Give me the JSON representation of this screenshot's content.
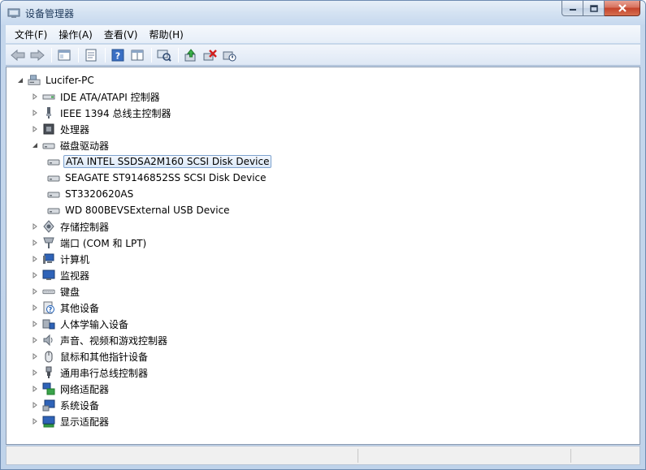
{
  "window": {
    "title": "设备管理器"
  },
  "menu": [
    {
      "label": "文件(F)"
    },
    {
      "label": "操作(A)"
    },
    {
      "label": "查看(V)"
    },
    {
      "label": "帮助(H)"
    }
  ],
  "toolbar": {
    "buttons": [
      {
        "icon": "back-arrow-icon"
      },
      {
        "icon": "forward-arrow-icon"
      },
      {
        "icon": "show-hide-tree-icon"
      },
      {
        "icon": "properties-icon"
      },
      {
        "icon": "help-icon"
      },
      {
        "icon": "view-panel-icon"
      },
      {
        "icon": "scan-hardware-icon"
      },
      {
        "icon": "update-driver-icon"
      },
      {
        "icon": "uninstall-icon"
      },
      {
        "icon": "disable-device-icon"
      }
    ]
  },
  "tree": {
    "root": "Lucifer-PC",
    "categories": [
      {
        "label": "IDE ATA/ATAPI 控制器",
        "icon": "ide-controller-icon",
        "expanded": false
      },
      {
        "label": "IEEE 1394 总线主控制器",
        "icon": "ieee1394-icon",
        "expanded": false
      },
      {
        "label": "处理器",
        "icon": "processor-icon",
        "expanded": false
      },
      {
        "label": "磁盘驱动器",
        "icon": "disk-drive-icon",
        "expanded": true,
        "children": [
          {
            "label": "ATA INTEL SSDSA2M160 SCSI Disk Device",
            "selected": true
          },
          {
            "label": "SEAGATE ST9146852SS SCSI Disk Device",
            "selected": false
          },
          {
            "label": "ST3320620AS",
            "selected": false
          },
          {
            "label": "WD 800BEVSExternal USB Device",
            "selected": false
          }
        ]
      },
      {
        "label": "存储控制器",
        "icon": "storage-controller-icon",
        "expanded": false
      },
      {
        "label": "端口 (COM 和 LPT)",
        "icon": "port-icon",
        "expanded": false
      },
      {
        "label": "计算机",
        "icon": "computer-icon",
        "expanded": false
      },
      {
        "label": "监视器",
        "icon": "monitor-icon",
        "expanded": false
      },
      {
        "label": "键盘",
        "icon": "keyboard-icon",
        "expanded": false
      },
      {
        "label": "其他设备",
        "icon": "other-devices-icon",
        "expanded": false
      },
      {
        "label": "人体学输入设备",
        "icon": "hid-icon",
        "expanded": false
      },
      {
        "label": "声音、视频和游戏控制器",
        "icon": "sound-icon",
        "expanded": false
      },
      {
        "label": "鼠标和其他指针设备",
        "icon": "mouse-icon",
        "expanded": false
      },
      {
        "label": "通用串行总线控制器",
        "icon": "usb-icon",
        "expanded": false
      },
      {
        "label": "网络适配器",
        "icon": "network-adapter-icon",
        "expanded": false
      },
      {
        "label": "系统设备",
        "icon": "system-devices-icon",
        "expanded": false
      },
      {
        "label": "显示适配器",
        "icon": "display-adapter-icon",
        "expanded": false
      }
    ]
  },
  "colors": {
    "selection_border": "#7da2ce",
    "titlebar": "#d4e2f2",
    "close": "#c4432b"
  }
}
